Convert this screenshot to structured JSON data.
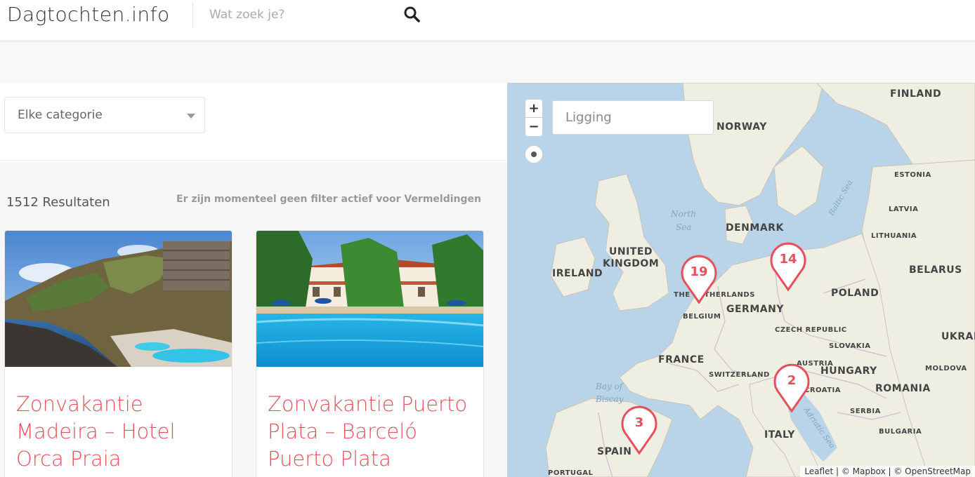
{
  "header": {
    "logo": "Dagtochten.info",
    "search_placeholder": "Wat zoek je?"
  },
  "filters": {
    "category_label": "Elke categorie"
  },
  "results": {
    "count_label": "1512 Resultaten",
    "filter_note": "Er zijn momenteel geen filter actief voor Vermeldingen"
  },
  "cards": [
    {
      "title": "Zonvakantie Madeira – Hotel Orca Praia"
    },
    {
      "title": "Zonvakantie Puerto Plata – Barceló Puerto Plata"
    }
  ],
  "map": {
    "zoom_in": "+",
    "zoom_out": "−",
    "location_placeholder": "Ligging",
    "countries": {
      "finland": "FINLAND",
      "norway": "NORWAY",
      "estonia": "ESTONIA",
      "latvia": "LATVIA",
      "lithuania": "LITHUANIA",
      "denmark": "DENMARK",
      "belarus": "BELARUS",
      "united": "UNITED",
      "kingdom": "KINGDOM",
      "ireland": "IRELAND",
      "netherlands": "THE NETHERLANDS",
      "poland": "POLAND",
      "belgium": "BELGIUM",
      "germany": "GERMANY",
      "czech": "CZECH REPUBLIC",
      "slovakia": "SLOVAKIA",
      "ukraine": "UKRAI",
      "france": "FRANCE",
      "switzerland": "SWITZERLAND",
      "austria": "AUSTRIA",
      "hungary": "HUNGARY",
      "moldova": "MOLDOVA",
      "croatia": "CROATIA",
      "romania": "ROMANIA",
      "serbia": "SERBIA",
      "bulgaria": "BULGARIA",
      "italy": "ITALY",
      "spain": "SPAIN",
      "portugal": "PORTUGAL"
    },
    "seas": {
      "north_sea_1": "North",
      "north_sea_2": "Sea",
      "baltic": "Baltic Sea",
      "biscay_1": "Bay of",
      "biscay_2": "Biscay",
      "adriatic": "Adriatic Sea"
    },
    "markers": {
      "netherlands": "19",
      "poland": "14",
      "italy": "2",
      "spain": "3"
    },
    "attribution": "Leaflet | © Mapbox | © OpenStreetMap"
  },
  "colors": {
    "accent": "#e6505a",
    "sea": "#b9d4e8",
    "land": "#eeeee2"
  }
}
